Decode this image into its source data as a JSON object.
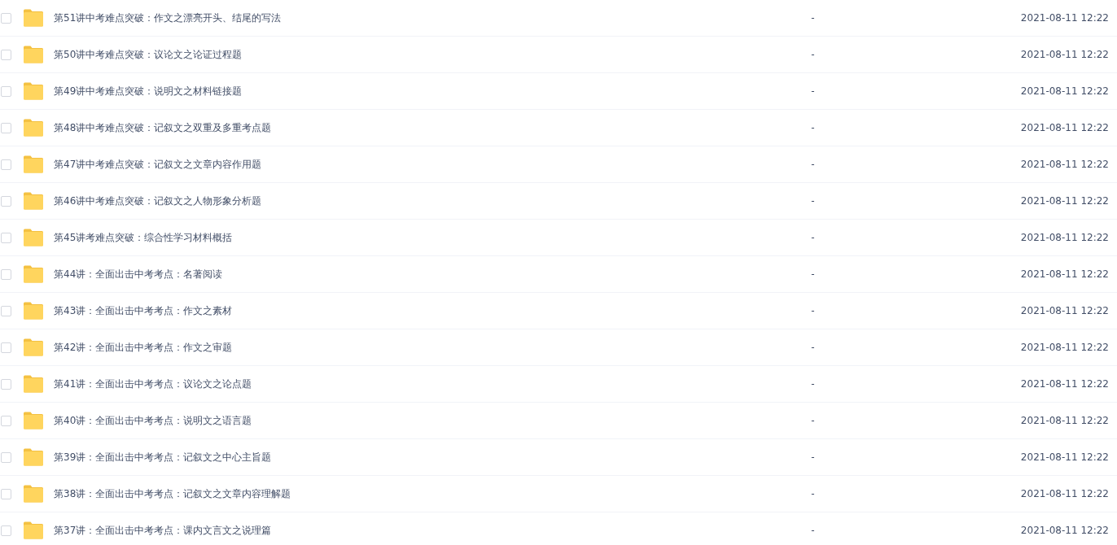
{
  "files": [
    {
      "name": "第51讲中考难点突破：作文之漂亮开头、结尾的写法",
      "size": "-",
      "modified": "2021-08-11 12:22",
      "checked": false
    },
    {
      "name": "第50讲中考难点突破：议论文之论证过程题",
      "size": "-",
      "modified": "2021-08-11 12:22",
      "checked": false
    },
    {
      "name": "第49讲中考难点突破：说明文之材料链接题",
      "size": "-",
      "modified": "2021-08-11 12:22",
      "checked": false
    },
    {
      "name": "第48讲中考难点突破：记叙文之双重及多重考点题",
      "size": "-",
      "modified": "2021-08-11 12:22",
      "checked": false
    },
    {
      "name": "第47讲中考难点突破：记叙文之文章内容作用题",
      "size": "-",
      "modified": "2021-08-11 12:22",
      "checked": false
    },
    {
      "name": "第46讲中考难点突破：记叙文之人物形象分析题",
      "size": "-",
      "modified": "2021-08-11 12:22",
      "checked": false
    },
    {
      "name": "第45讲考难点突破：综合性学习材料概括",
      "size": "-",
      "modified": "2021-08-11 12:22",
      "checked": false
    },
    {
      "name": "第44讲：全面出击中考考点：名著阅读",
      "size": "-",
      "modified": "2021-08-11 12:22",
      "checked": false
    },
    {
      "name": "第43讲：全面出击中考考点：作文之素材",
      "size": "-",
      "modified": "2021-08-11 12:22",
      "checked": false
    },
    {
      "name": "第42讲：全面出击中考考点：作文之审题",
      "size": "-",
      "modified": "2021-08-11 12:22",
      "checked": false
    },
    {
      "name": "第41讲：全面出击中考考点：议论文之论点题",
      "size": "-",
      "modified": "2021-08-11 12:22",
      "checked": false
    },
    {
      "name": "第40讲：全面出击中考考点：说明文之语言题",
      "size": "-",
      "modified": "2021-08-11 12:22",
      "checked": false
    },
    {
      "name": "第39讲：全面出击中考考点：记叙文之中心主旨题",
      "size": "-",
      "modified": "2021-08-11 12:22",
      "checked": false
    },
    {
      "name": "第38讲：全面出击中考考点：记叙文之文章内容理解题",
      "size": "-",
      "modified": "2021-08-11 12:22",
      "checked": false
    },
    {
      "name": "第37讲：全面出击中考考点：课内文言文之说理篇",
      "size": "-",
      "modified": "2021-08-11 12:22",
      "checked": false
    }
  ]
}
